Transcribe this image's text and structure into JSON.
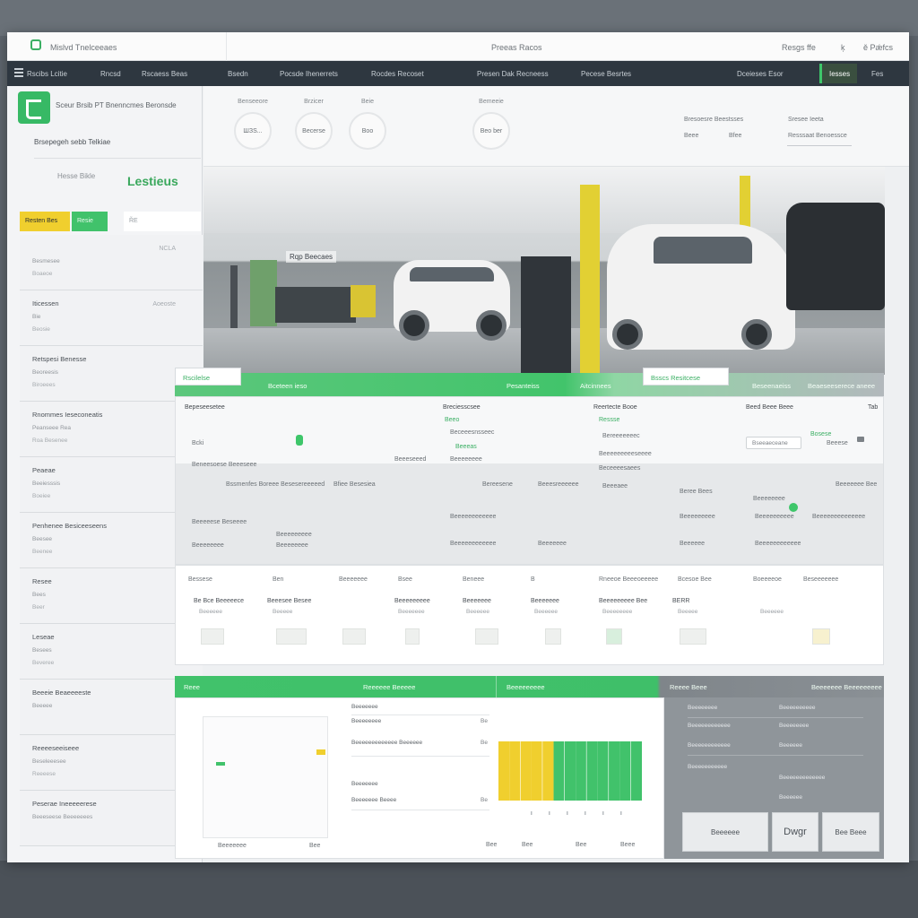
{
  "titlebar": {
    "app_name": "Mislvd Tnelceeaes",
    "center_title": "Preeas Racos",
    "right_a": "Resgs ffe",
    "right_b": "ķ",
    "right_c": "ě Pǽfcs"
  },
  "nav": {
    "items": [
      "Rscibs Lcitie",
      "Rncsd",
      "Rscaess Beas",
      "Bsedn",
      "Pocsde Ihenerrets",
      "Rocdes Recoset",
      "Presen Dak Recneess",
      "Pecese Besrtes",
      "Dceieses Esor",
      "Iesses",
      "Fes"
    ],
    "active_index": 9
  },
  "sidebar": {
    "brand_text": "Sceur Brsib PT Bnenncmes Beronsde",
    "subtitle": "Brsepegeh sebb Telkiae",
    "mini": "Hesse Bikle",
    "brand_green": "Lestieus",
    "tabs": [
      "Resten Bes",
      "Resie",
      "ŘE"
    ],
    "items": [
      {
        "title": "",
        "sub1": "Besmesee",
        "sub2": "Boaeoe",
        "right": "NCLA"
      },
      {
        "title": "Iticessen",
        "sub1": "Bie",
        "sub2": "Beosie",
        "right": "Aoeoste"
      },
      {
        "title": "Retspesi Benesse",
        "sub1": "Beoreesis",
        "sub2": "Biroeees",
        "right": ""
      },
      {
        "title": "Rnommes Ieseconeatis",
        "sub1": "Peanseee Rea",
        "sub2": "Roa Besenee",
        "right": ""
      },
      {
        "title": "Peaeae",
        "sub1": "Beeiesssis",
        "sub2": "Boeiee",
        "right": ""
      },
      {
        "title": "Penhenee Besiceeseens",
        "sub1": "Beesee",
        "sub2": "Beenee",
        "right": ""
      },
      {
        "title": "Resee",
        "sub1": "Bees",
        "sub2": "Beer",
        "right": ""
      },
      {
        "title": "Leseae",
        "sub1": "Besees",
        "sub2": "Beveree",
        "right": ""
      },
      {
        "title": "Beeeie Beaeeeeste",
        "sub1": "Beeeee",
        "sub2": "",
        "right": ""
      },
      {
        "title": "Reeeeseeiseee",
        "sub1": "Beseleeesee",
        "sub2": "Reeeese",
        "right": ""
      },
      {
        "title": "Peserae Ineeeeerese",
        "sub1": "Beeeseese Beeeeeees",
        "sub2": "",
        "right": ""
      }
    ]
  },
  "header": {
    "stats": [
      {
        "label": "Benseeore",
        "value": "ШЗS..."
      },
      {
        "label": "Brzicer",
        "value": "Becerse"
      },
      {
        "label": "Beie",
        "value": "Boo"
      },
      {
        "label": "Bemeeie",
        "value": "Beo ber"
      }
    ],
    "right_1": "Bresoesre Beestsses",
    "right_2": "Sresee Ieeta",
    "right_3": "Beee",
    "right_4": "Bfee",
    "right_5": "Resssaat Benoessce"
  },
  "hero": {
    "sign": "Rqp Beecaes"
  },
  "section_bar": {
    "left_box": "Rscilelse",
    "seg_1": "Bceteen ieso",
    "seg_2": "Pesanteiss",
    "seg_3": "Aitcinnees",
    "right_box": "Bsscs Resitcese",
    "seg_4": "Beseenaeiss",
    "seg_5": "Beaeseeserece aneee"
  },
  "data_panel": {
    "c1_title": "Bepeseesetee",
    "c1_val": "Bcki",
    "c1_sub": "Beneesoese Beeeseee",
    "c2_title": "Breciesscsee",
    "c2_a": "Beeo",
    "c2_b": "Beceeesnsseec",
    "c2_c": "Beeeas",
    "c2_d": "Beeeeeeee",
    "c2_e": "Beeeseeed",
    "c3_title": "Reertecte Booe",
    "c3_a": "Ressse",
    "c3_b": "Bereeeeeeec",
    "c3_c": "Beeeeeeeeeseeee",
    "c3_d": "Beceeeesaees",
    "c4_title": "Beed Beee Beee",
    "c4_pill": "Bseeaeceane",
    "c4_a": "Bosese",
    "c4_b": "Beeese",
    "c4_right": "Tab",
    "r2": [
      "Bssmenfes Boreee Besesereeeeed",
      "Bfiee Besesiea",
      "Bereesene",
      "Beeesreeeeee",
      "Beeeaee",
      "Beree Bees",
      "Beeeeeeee",
      "Beeeeeee Bee"
    ],
    "r3": [
      "Beeeeese Beseeee",
      "Beeeeeeeee",
      "Beeeeeeeeeeee",
      "Beeeeeeeee",
      "Beeeeeeeeee",
      "Beeeeeeeeeeeeee"
    ],
    "r4": [
      "Beeeeeeee",
      "Beeeeeeee",
      "Beeeeeeeeeeee",
      "Beeeeeee",
      "Beeeeee",
      "Beeeeeeeeeeee"
    ]
  },
  "grid": {
    "headers": [
      "Bessese",
      "Ben",
      "Beeeeeee",
      "Bsee",
      "Beneee",
      "B",
      "Rneeoe Beeeoeeeee",
      "Bcesoe Bee",
      "Boeeeeoe",
      "Beseeeeeee"
    ],
    "values": [
      "Be Bce Beeeeece",
      "Beeesee Besee",
      "Beeeeeeeee",
      "Beeeeeee",
      "Beeeeeee",
      "Beeeeeeeee Bee",
      "BERR"
    ],
    "subs": [
      "Beeeeee",
      "Beeeee",
      "Beeeeeee",
      "Beeeeee",
      "Beeeeee",
      "Beeeeeeee",
      "Beeeee",
      "Beeeeee"
    ]
  },
  "bottom_bar": {
    "seg_1": "Reee",
    "seg_2": "Reeeeee Beeeee",
    "seg_3": "Beeeeeeeee",
    "seg_4": "Reeee Beee",
    "seg_5": "Beeeeeee Beeeeeeeee"
  },
  "bottom_left": {
    "list": [
      {
        "label": "Beeeeeee",
        "value": ""
      },
      {
        "label": "Beeeeeeee",
        "value": "Be"
      },
      {
        "label": "Beeeeeeeeeeeee Beeeeee",
        "value": "Be"
      },
      {
        "label": "Beeeeeee",
        "value": ""
      },
      {
        "label": "Beeeeeee Beeee",
        "value": "Be"
      }
    ],
    "card_footer_left": "Beeeeeee",
    "card_footer_right": "Bee",
    "footer": [
      "Bee",
      "Bee",
      "Bee",
      "Beee"
    ]
  },
  "chart_data": {
    "type": "bar",
    "categories": [
      "",
      "",
      "",
      "",
      "",
      "",
      "",
      "",
      "",
      "",
      "",
      "",
      ""
    ],
    "values": [
      1,
      1,
      1,
      1,
      1,
      1,
      1,
      1,
      1,
      1,
      1,
      1,
      1
    ],
    "colors": [
      "#f0cf2e",
      "#f0cf2e",
      "#f0cf2e",
      "#f0cf2e",
      "#f0cf2e",
      "#41c26b",
      "#41c26b",
      "#41c26b",
      "#41c26b",
      "#41c26b",
      "#41c26b",
      "#41c26b",
      "#41c26b"
    ],
    "title": "",
    "xlabel": "",
    "ylabel": "",
    "ylim": [
      0,
      1
    ]
  },
  "bottom_right": {
    "list": [
      "Beeeeeeee",
      "Beeeeeeeeee",
      "Beeeeeeeeeeee",
      "Beeeeeeee",
      "Beeeeeeeeeeee",
      "Beeeeee",
      "Beeeeeeeeeee",
      "Beeeeeeeeeeeee",
      "Beeeeee"
    ],
    "buttons": [
      "Beeeeee",
      "Dwgr",
      "Bee Beee"
    ]
  },
  "colors": {
    "accent_green": "#41c26b",
    "accent_yellow": "#f0cf2e",
    "navbar": "#2e3740"
  }
}
